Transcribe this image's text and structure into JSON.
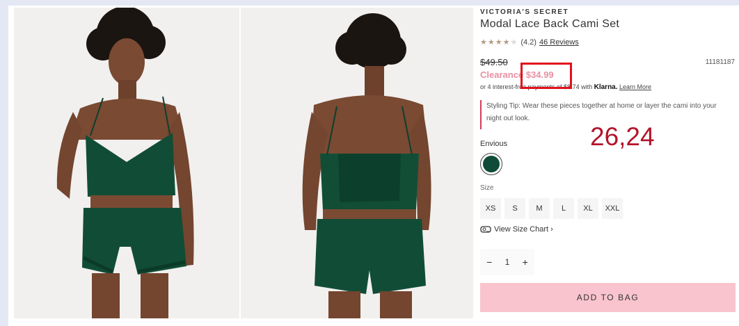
{
  "product": {
    "brand": "VICTORIA'S SECRET",
    "title": "Modal Lace Back Cami Set",
    "rating_value": "(4.2)",
    "rating_stars": 4.2,
    "reviews_label": "46 Reviews",
    "old_price": "$49.50",
    "sku": "11181187",
    "clearance_label": "Clearance",
    "clearance_price": "$34.99",
    "klarna_text": "or 4 interest-free payments of $8.74 with",
    "klarna_logo": "Klarna.",
    "klarna_link": "Learn More",
    "styling_tip": "Styling Tip: Wear these pieces together at home or layer the cami into your night out look.",
    "color_label": "Envious",
    "color_hex": "#0f4b38",
    "size_label": "Size",
    "sizes": [
      "XS",
      "S",
      "M",
      "L",
      "XL",
      "XXL"
    ],
    "size_chart_label": "View Size Chart ›",
    "qty_minus": "−",
    "qty_value": "1",
    "qty_plus": "+",
    "add_to_bag": "ADD TO BAG"
  },
  "annotation": {
    "text": "26,24",
    "highlight_color": "#e2101c"
  }
}
